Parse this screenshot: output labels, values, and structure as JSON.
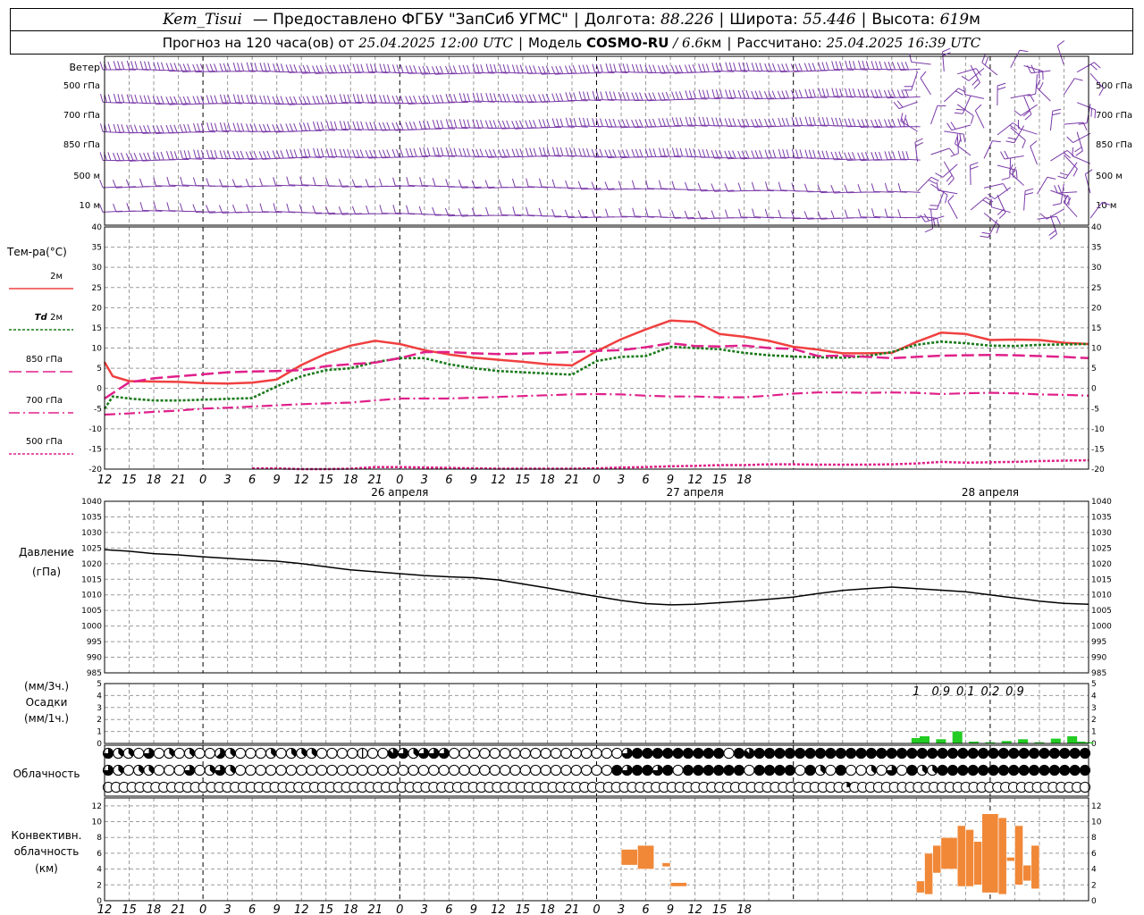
{
  "header": {
    "station": "Kem_Tisui",
    "provider": "— Предоставлено ФГБУ \"ЗапСиб УГМС\"",
    "lon_label": "Долгота:",
    "lon_value": "88.226",
    "lat_label": "Широта:",
    "lat_value": "55.446",
    "alt_label": "Высота:",
    "alt_value": "619",
    "alt_unit": "м",
    "forecast_prefix": "Прогноз на 120 часа(ов) от",
    "forecast_time": "25.04.2025 12:00 UTC",
    "model_label": "Модель",
    "model_name": "COSMO-RU",
    "model_res": "/ 6.6",
    "model_res_unit": "км",
    "calc_label": "Рассчитано:",
    "calc_time": "25.04.2025 16:39 UTC"
  },
  "colors": {
    "t2m": "#f04040",
    "td2m": "#1a7a1a",
    "t850": "#e0208a",
    "t700": "#e0208a",
    "t500": "#e0208a",
    "wind": "#7a3aa8",
    "precip": "#22cc22",
    "conv": "#f08838",
    "grid": "#9a9a9a"
  },
  "chart_data": [
    {
      "type": "wind-barbs",
      "title": "Ветер",
      "levels": [
        "500 гПа",
        "700 гПа",
        "850 гПа",
        "500 м",
        "10 м"
      ]
    },
    {
      "type": "line",
      "ylabel": "Тем-ра(°C)",
      "ylim": [
        -20,
        40
      ],
      "yticks": [
        -20,
        -15,
        -10,
        -5,
        0,
        5,
        10,
        15,
        20,
        25,
        30,
        35,
        40
      ],
      "x_ticks": [
        "12",
        "15",
        "18",
        "21",
        "0",
        "3",
        "6",
        "9",
        "12",
        "15",
        "18",
        "21",
        "0",
        "3",
        "6",
        "9",
        "12",
        "15",
        "18",
        "21",
        "0",
        "3",
        "6",
        "9",
        "12",
        "15",
        "18"
      ],
      "date_labels": [
        {
          "hour": 36,
          "text": "26 апреля"
        },
        {
          "hour": 72,
          "text": "27 апреля"
        },
        {
          "hour": 108,
          "text": "28 апреля"
        }
      ],
      "series": [
        {
          "name": "2м",
          "key": "t2m",
          "x": [
            0,
            1,
            3,
            6,
            9,
            12,
            15,
            18,
            21,
            24,
            27,
            30,
            33,
            36,
            39,
            42,
            45,
            48,
            51,
            54,
            57,
            60,
            63,
            66,
            69,
            72,
            75,
            78,
            81,
            84,
            87,
            90,
            93,
            96,
            99,
            102,
            105,
            108,
            111,
            114,
            117,
            120
          ],
          "values": [
            6.5,
            3,
            1.8,
            1.7,
            1.6,
            1.3,
            1.2,
            1.4,
            2.2,
            5.8,
            8.6,
            10.6,
            11.8,
            11,
            9.5,
            8.4,
            7.6,
            7.1,
            6.6,
            6,
            5.7,
            9.2,
            12.2,
            14.6,
            16.8,
            16.5,
            13.5,
            12.8,
            11.8,
            10.3,
            9.6,
            8.7,
            8.7,
            8.8,
            11.5,
            13.8,
            13.5,
            12,
            12.1,
            12,
            11.3,
            11
          ]
        },
        {
          "name": "Td 2м",
          "key": "td2m",
          "x": [
            0,
            1,
            3,
            6,
            9,
            12,
            15,
            18,
            21,
            24,
            27,
            30,
            33,
            36,
            39,
            42,
            45,
            48,
            51,
            54,
            57,
            60,
            63,
            66,
            69,
            72,
            75,
            78,
            81,
            84,
            87,
            90,
            93,
            96,
            99,
            102,
            105,
            108,
            111,
            114,
            117,
            120
          ],
          "values": [
            -5,
            -2,
            -2.5,
            -3,
            -3,
            -2.8,
            -2.6,
            -2.4,
            0.5,
            3,
            4.5,
            5,
            6.5,
            7.5,
            7.5,
            6,
            5,
            4.3,
            4,
            3.7,
            3.4,
            6.8,
            7.8,
            8,
            10.3,
            10,
            9.7,
            8.8,
            8.2,
            7.9,
            7.7,
            7.6,
            8,
            9,
            10.8,
            11.6,
            11.2,
            10.6,
            10.5,
            10.8,
            10.9,
            11
          ]
        },
        {
          "name": "850 гПа",
          "key": "t850",
          "x": [
            0,
            3,
            6,
            9,
            12,
            15,
            18,
            21,
            24,
            27,
            30,
            33,
            36,
            39,
            42,
            45,
            48,
            51,
            54,
            57,
            60,
            63,
            66,
            69,
            72,
            75,
            78,
            81,
            84,
            87,
            90,
            93,
            96,
            99,
            102,
            105,
            108,
            111,
            114,
            117,
            120
          ],
          "values": [
            -2.5,
            1.5,
            2.5,
            3,
            3.5,
            4,
            4.2,
            4.3,
            4.5,
            5.5,
            6,
            6.4,
            7.5,
            9,
            9,
            8.7,
            8.5,
            8.6,
            8.8,
            9,
            9.3,
            9.5,
            10.2,
            11.2,
            10.5,
            10.4,
            10.6,
            10,
            9.8,
            8,
            8.1,
            7.8,
            7.5,
            7.8,
            8.1,
            8.2,
            8.3,
            8.2,
            8,
            7.8,
            7.5
          ]
        },
        {
          "name": "700 гПа",
          "key": "t700",
          "x": [
            0,
            3,
            6,
            9,
            12,
            15,
            18,
            21,
            24,
            27,
            30,
            33,
            36,
            39,
            42,
            45,
            48,
            51,
            54,
            57,
            60,
            63,
            66,
            69,
            72,
            75,
            78,
            81,
            84,
            87,
            90,
            93,
            96,
            99,
            102,
            105,
            108,
            111,
            114,
            117,
            120
          ],
          "values": [
            -6.5,
            -6.2,
            -5.8,
            -5.5,
            -5,
            -4.8,
            -4.5,
            -4.2,
            -3.9,
            -3.7,
            -3.5,
            -3,
            -2.5,
            -2.5,
            -2.5,
            -2.3,
            -2.1,
            -1.9,
            -1.7,
            -1.5,
            -1.4,
            -1.5,
            -1.8,
            -2,
            -2,
            -2.2,
            -2.2,
            -1.8,
            -1.3,
            -1,
            -1,
            -1.1,
            -1,
            -1.1,
            -1.4,
            -1.2,
            -1.1,
            -1.2,
            -1.5,
            -1.6,
            -1.8
          ]
        },
        {
          "name": "500 гПа",
          "key": "t500",
          "x": [
            18,
            21,
            24,
            27,
            30,
            33,
            36,
            39,
            42,
            45,
            48,
            51,
            54,
            57,
            60,
            63,
            66,
            69,
            72,
            75,
            78,
            81,
            84,
            87,
            90,
            93,
            96,
            99,
            102,
            105,
            108,
            111,
            114,
            117,
            120
          ],
          "values": [
            -19.8,
            -19.8,
            -20,
            -20,
            -19.9,
            -19.5,
            -19.5,
            -19.6,
            -19.7,
            -19.8,
            -19.9,
            -19.9,
            -19.9,
            -19.9,
            -19.8,
            -19.6,
            -19.5,
            -19.3,
            -19.2,
            -19,
            -19,
            -18.8,
            -18.8,
            -18.9,
            -18.9,
            -18.9,
            -18.8,
            -18.6,
            -18.2,
            -18.4,
            -18.3,
            -18.2,
            -18,
            -17.9,
            -17.8
          ]
        }
      ]
    },
    {
      "type": "line",
      "ylabel": "Давление",
      "ylabel2": "(гПа)",
      "ylim": [
        985,
        1040
      ],
      "yticks": [
        985,
        990,
        995,
        1000,
        1005,
        1010,
        1015,
        1020,
        1025,
        1030,
        1035,
        1040
      ],
      "x": [
        0,
        3,
        6,
        9,
        12,
        15,
        18,
        21,
        24,
        27,
        30,
        33,
        36,
        39,
        42,
        45,
        48,
        51,
        54,
        57,
        60,
        63,
        66,
        69,
        72,
        75,
        78,
        81,
        84,
        87,
        90,
        93,
        96,
        99,
        102,
        105,
        108,
        111,
        114,
        117,
        120
      ],
      "values": [
        1024.5,
        1024,
        1023.2,
        1022.8,
        1022.2,
        1021.7,
        1021.2,
        1020.8,
        1020,
        1019,
        1018,
        1017.4,
        1016.8,
        1016.2,
        1015.8,
        1015.5,
        1014.8,
        1013.5,
        1012.2,
        1010.8,
        1009.5,
        1008.2,
        1007.2,
        1006.8,
        1007,
        1007.5,
        1008,
        1008.6,
        1009.3,
        1010.4,
        1011.4,
        1012,
        1012.5,
        1012,
        1011.5,
        1011,
        1010,
        1009,
        1008,
        1007.3,
        1007
      ]
    },
    {
      "type": "bar",
      "ylabel": "Осадки",
      "ylabel_top": "(мм/3ч.)",
      "ylabel_bottom": "(мм/1ч.)",
      "ylim": [
        0,
        5
      ],
      "yticks": [
        0,
        1,
        2,
        3,
        4,
        5
      ],
      "hours": [
        99,
        100,
        102,
        104,
        106,
        108,
        110,
        112,
        114,
        116,
        118,
        119,
        120
      ],
      "values": [
        0.45,
        0.6,
        0.35,
        1.0,
        0.15,
        0.1,
        0.2,
        0.35,
        0.1,
        0.4,
        0.6,
        0.15,
        0.1
      ],
      "totals": [
        {
          "hour": 99,
          "text": "1"
        },
        {
          "hour": 102,
          "text": "0.9"
        },
        {
          "hour": 105,
          "text": "0.1"
        },
        {
          "hour": 108,
          "text": "0.2"
        },
        {
          "hour": 111,
          "text": "0.9"
        }
      ]
    },
    {
      "type": "symbols",
      "ylabel": "Облачность",
      "rows": [
        "6330603030053000303330000100763666000000000000000006888888888087888888888888888888888888888888888",
        "6303300060363000000000000000000000000000000000000086886808888880888808308003060833888888888888888",
        "0000000000000000000000000000000000000000000000000000000000000000000000000000000000000000000002000000000000000000000000000000"
      ]
    },
    {
      "type": "range-bar",
      "ylabel": "Конвективн.",
      "ylabel2": "облачность",
      "ylabel3": "(км)",
      "ylim": [
        0,
        13
      ],
      "yticks": [
        0,
        2,
        4,
        6,
        8,
        10,
        12
      ],
      "bars": [
        {
          "x0": 63,
          "x1": 65,
          "base": 4.5,
          "top": 6.5
        },
        {
          "x0": 65,
          "x1": 67,
          "base": 4,
          "top": 7
        },
        {
          "x0": 68,
          "x1": 69,
          "base": 4.3,
          "top": 4.8
        },
        {
          "x0": 69,
          "x1": 71,
          "base": 1.8,
          "top": 2.3
        },
        {
          "x0": 99,
          "x1": 100,
          "base": 1,
          "top": 2.5
        },
        {
          "x0": 100,
          "x1": 101,
          "base": 0.8,
          "top": 6
        },
        {
          "x0": 101,
          "x1": 102,
          "base": 3.5,
          "top": 7
        },
        {
          "x0": 102,
          "x1": 104,
          "base": 4,
          "top": 8
        },
        {
          "x0": 104,
          "x1": 105,
          "base": 1.8,
          "top": 9.5
        },
        {
          "x0": 105,
          "x1": 106,
          "base": 1.8,
          "top": 9
        },
        {
          "x0": 106,
          "x1": 107,
          "base": 2,
          "top": 7.5
        },
        {
          "x0": 107,
          "x1": 109,
          "base": 1,
          "top": 11
        },
        {
          "x0": 109,
          "x1": 110,
          "base": 0.8,
          "top": 10.5
        },
        {
          "x0": 110,
          "x1": 111,
          "base": 5,
          "top": 5.5
        },
        {
          "x0": 111,
          "x1": 112,
          "base": 2,
          "top": 9.5
        },
        {
          "x0": 112,
          "x1": 113,
          "base": 2.5,
          "top": 4.5
        },
        {
          "x0": 113,
          "x1": 114,
          "base": 1.5,
          "top": 7
        }
      ]
    }
  ]
}
